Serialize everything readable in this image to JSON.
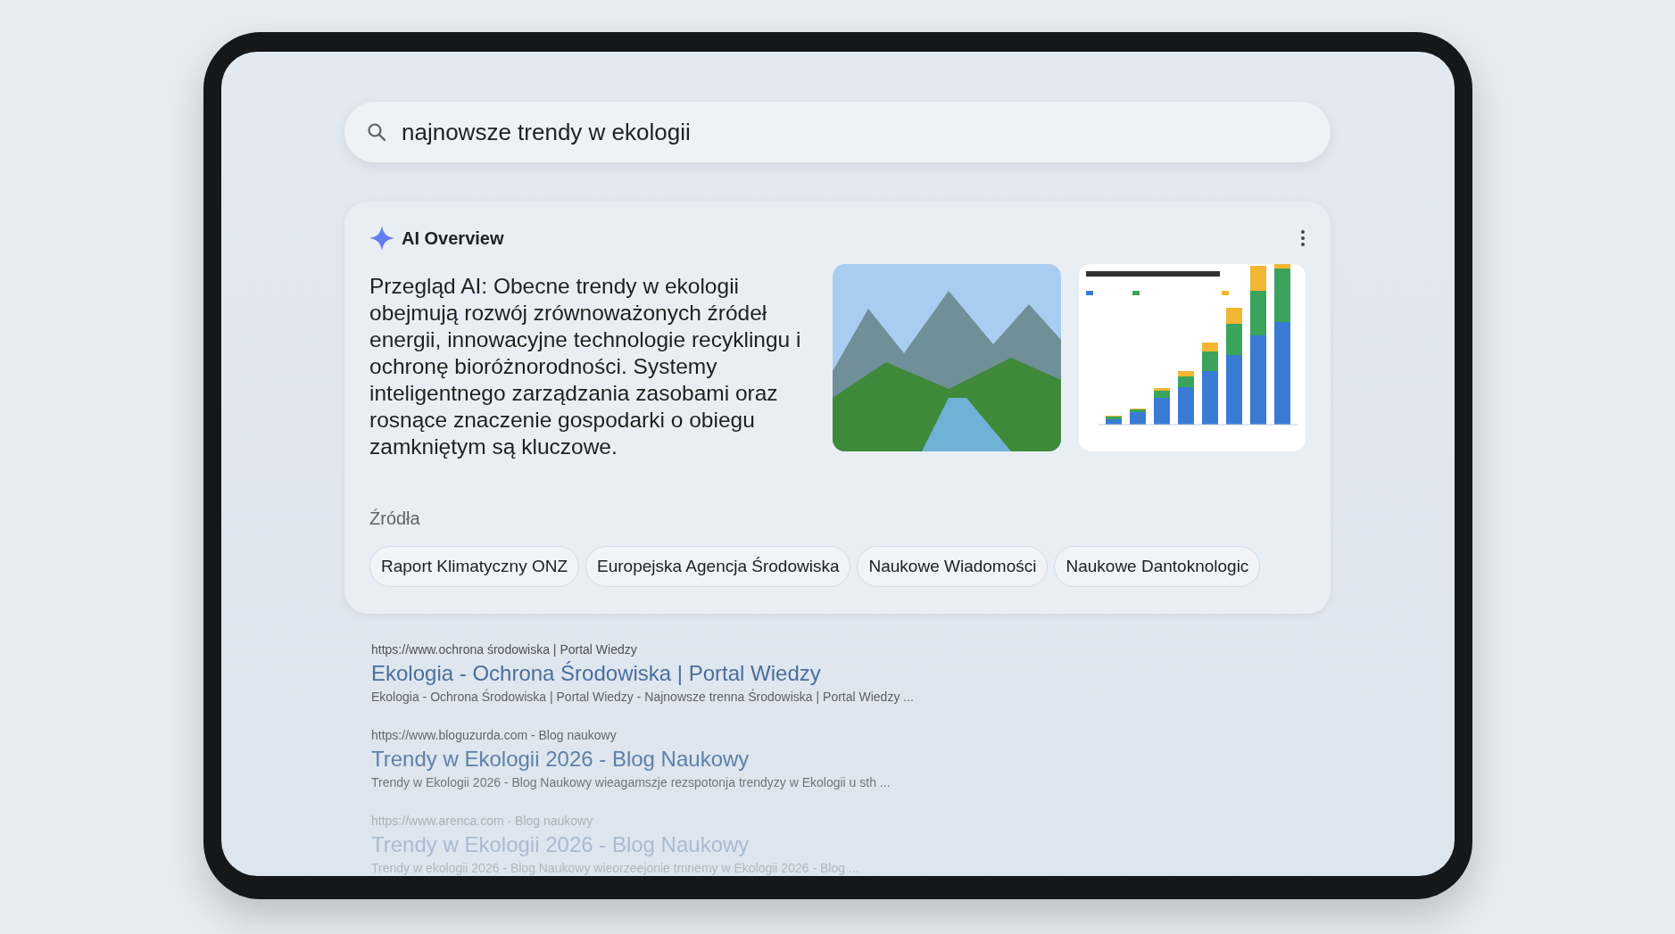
{
  "search": {
    "query": "najnowsze trendy w ekologii"
  },
  "overview": {
    "title": "AI Overview",
    "text": "Przegląd AI: Obecne trendy w ekologii obejmują rozwój zrównoważonych źródeł energii, innowacyjne technologie recyklingu i ochronę bioróżnorodności. Systemy inteligentnego zarządzania zasobami oraz rosnące znaczenie gospodarki o obiegu zamkniętym są kluczowe.",
    "sources_label": "Źródła",
    "sources": [
      "Raport Klimatyczny ONZ",
      "Europejska Agencja Środowiska",
      "Naukowe Wiadomości",
      "Naukowe Dantoknologic"
    ]
  },
  "results": [
    {
      "url": "https://www.ochrona środowiska | Portal Wiedzy",
      "title": "Ekologia - Ochrona Środowiska | Portal Wiedzy",
      "snippet": "Ekologia - Ochrona Środowiska | Portal Wiedzy - Najnowsze trenna Środowiska | Portal Wiedzy ..."
    },
    {
      "url": "https://www.bloguzurda.com - Blog naukowy",
      "title": "Trendy w Ekologii 2026 - Blog Naukowy",
      "snippet": "Trendy w Ekologii 2026 - Blog Naukowy wieagamszje rezspotonja trendyzy w Ekologii u sth ..."
    },
    {
      "url": "https://www.arenca.com · Blog naukowy",
      "title": "Trendy w Ekologii 2026 - Blog Naukowy",
      "snippet": "Trendy w ekologii 2026 - Blog Naukowy wieorzeejonie tmnemy w Ekologii 2026 - Blog ..."
    }
  ]
}
